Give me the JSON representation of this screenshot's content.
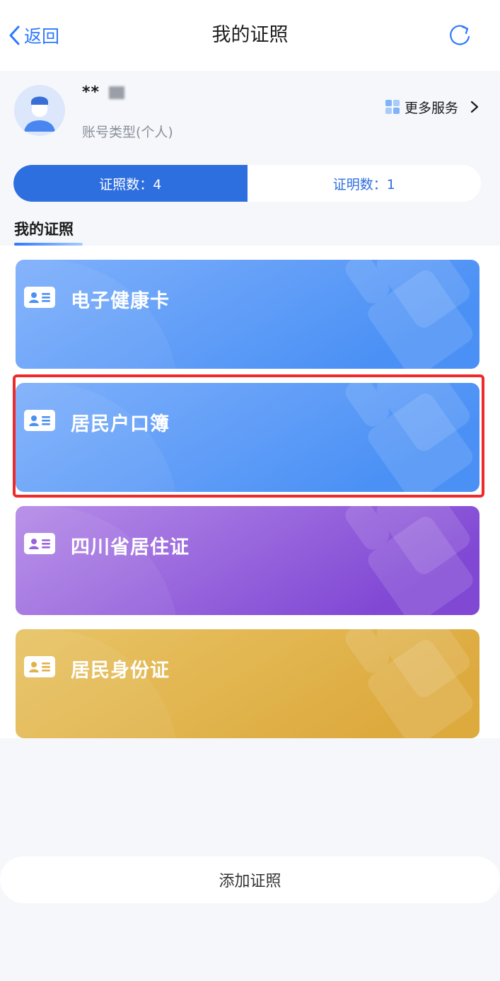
{
  "nav": {
    "back_label": "返回",
    "title": "我的证照",
    "refresh_icon": "refresh-icon"
  },
  "profile": {
    "username": "**",
    "account_type": "账号类型(个人)",
    "more_services_label": "更多服务"
  },
  "tabs": [
    {
      "label": "证照数：4",
      "active": true
    },
    {
      "label": "证明数：1",
      "active": false
    }
  ],
  "section": {
    "title": "我的证照"
  },
  "cards": [
    {
      "label": "电子健康卡",
      "color_start": "#7fb0fb",
      "color_end": "#4a90f5",
      "highlighted": false
    },
    {
      "label": "居民户口簿",
      "color_start": "#7fb0fb",
      "color_end": "#4a90f5",
      "highlighted": true
    },
    {
      "label": "四川省居住证",
      "color_start": "#b58ce8",
      "color_end": "#8148d4",
      "highlighted": false
    },
    {
      "label": "居民身份证",
      "color_start": "#e8c466",
      "color_end": "#ddaa3e",
      "highlighted": false
    }
  ],
  "add_button": {
    "label": "添加证照"
  },
  "colors": {
    "accent": "#2e6fe0",
    "highlight_border": "#ef2a2a"
  }
}
